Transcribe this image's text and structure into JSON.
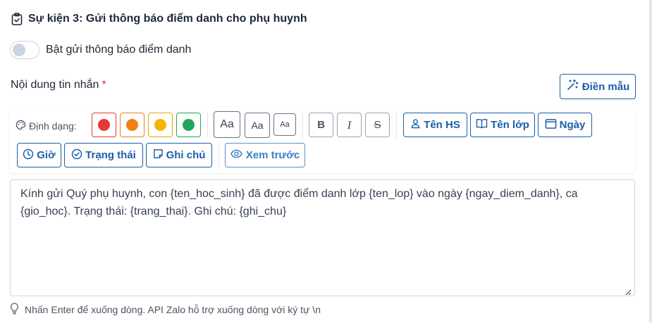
{
  "event": {
    "title": "Sự kiện 3: Gửi thông báo điểm danh cho phụ huynh",
    "icon": "clipboard-check-icon"
  },
  "toggle": {
    "label": "Bật gửi thông báo điểm danh",
    "checked": false
  },
  "content": {
    "label": "Nội dung tin nhắn",
    "required_mark": "*",
    "fill_template_label": "Điền mẫu"
  },
  "toolbar": {
    "format_label": "Định dạng:",
    "colors": [
      "#e53935",
      "#f07f16",
      "#f5b400",
      "#21a65a"
    ],
    "color_borders": [
      "#e53935",
      "#f07f16",
      "#e6a700",
      "#21a65a"
    ],
    "sizes": [
      "Aa",
      "Aa",
      "Aa"
    ],
    "styles": {
      "bold": "B",
      "italic": "I",
      "strike": "S"
    },
    "variables": {
      "student": "Tên HS",
      "class": "Tên lớp",
      "date": "Ngày",
      "time": "Giờ",
      "status": "Trạng thái",
      "note": "Ghi chú"
    },
    "preview_label": "Xem trước"
  },
  "message": {
    "value": "Kính gửi Quý phụ huynh, con {ten_hoc_sinh} đã được điểm danh lớp {ten_lop} vào ngày {ngay_diem_danh}, ca {gio_hoc}. Trạng thái: {trang_thai}. Ghi chú: {ghi_chu}"
  },
  "hint": {
    "text": "Nhấn Enter để xuống dòng. API Zalo hỗ trợ xuống dòng với ký tự \\n"
  },
  "theme": {
    "accent": "#1d5fa8",
    "required": "#e53935"
  }
}
